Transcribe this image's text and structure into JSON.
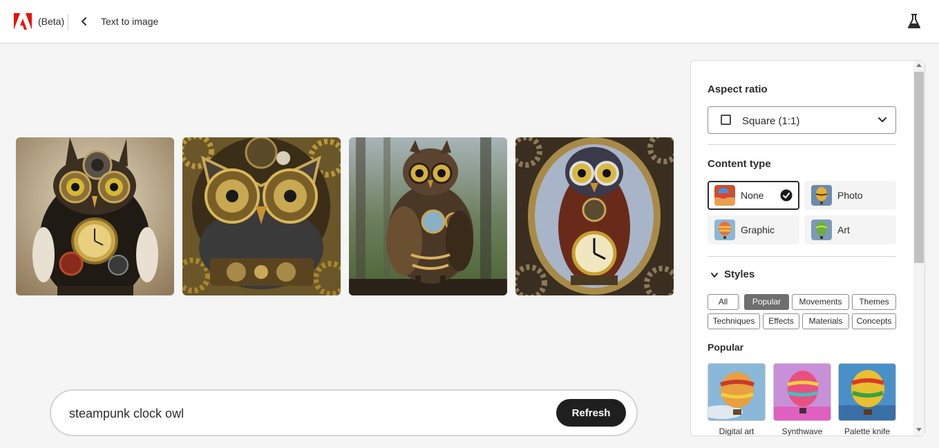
{
  "header": {
    "beta_label": "(Beta)",
    "page_title": "Text to image"
  },
  "gallery": {
    "images": [
      {
        "subject": "steampunk owl with pointed ears and clock gears on chest"
      },
      {
        "subject": "steampunk owl face framed by brass gears"
      },
      {
        "subject": "steampunk owl standing on branch in forest"
      },
      {
        "subject": "steampunk owl in oval frame with large clock"
      }
    ]
  },
  "prompt": {
    "value": "steampunk clock owl",
    "refresh_label": "Refresh"
  },
  "panel": {
    "aspect_ratio": {
      "label": "Aspect ratio",
      "selected": "Square (1:1)"
    },
    "content_type": {
      "label": "Content type",
      "options": [
        {
          "label": "None",
          "selected": true
        },
        {
          "label": "Photo",
          "selected": false
        },
        {
          "label": "Graphic",
          "selected": false
        },
        {
          "label": "Art",
          "selected": false
        }
      ]
    },
    "styles": {
      "label": "Styles",
      "filters": [
        {
          "label": "All",
          "active": false
        },
        {
          "label": "Popular",
          "active": true
        },
        {
          "label": "Movements",
          "active": false
        },
        {
          "label": "Themes",
          "active": false
        },
        {
          "label": "Techniques",
          "active": false
        },
        {
          "label": "Effects",
          "active": false
        },
        {
          "label": "Materials",
          "active": false
        },
        {
          "label": "Concepts",
          "active": false
        }
      ],
      "section_label": "Popular",
      "items": [
        {
          "label": "Digital art"
        },
        {
          "label": "Synthwave"
        },
        {
          "label": "Palette knife"
        }
      ]
    }
  },
  "colors": {
    "adobe_red": "#eb1000",
    "refresh_bg": "#1f1f1f",
    "active_chip": "#6e6e6e"
  }
}
